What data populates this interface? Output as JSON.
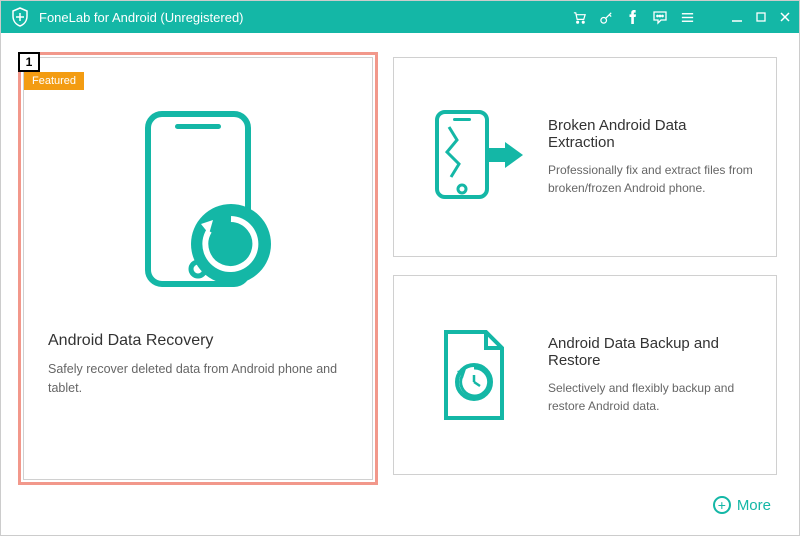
{
  "titlebar": {
    "app_title": "FoneLab for Android (Unregistered)"
  },
  "highlight": {
    "number": "1"
  },
  "featured_label": "Featured",
  "card_recovery": {
    "title": "Android Data Recovery",
    "desc": "Safely recover deleted data from Android phone and tablet."
  },
  "card_extraction": {
    "title": "Broken Android Data Extraction",
    "desc": "Professionally fix and extract files from broken/frozen Android phone."
  },
  "card_backup": {
    "title": "Android Data Backup and Restore",
    "desc": "Selectively and flexibly backup and restore Android data."
  },
  "more_label": "More",
  "colors": {
    "accent": "#14B7A6",
    "featured": "#F39C12",
    "highlight_frame": "#F2988B"
  }
}
